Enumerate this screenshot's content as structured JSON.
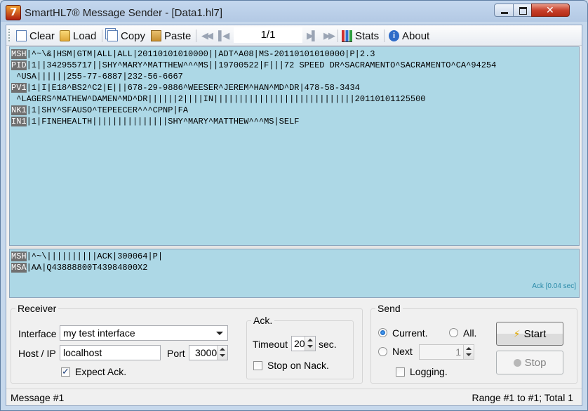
{
  "window": {
    "title": "SmartHL7® Message Sender -  [Data1.hl7]"
  },
  "toolbar": {
    "clear": "Clear",
    "load": "Load",
    "copy": "Copy",
    "paste": "Paste",
    "pager": "1/1",
    "stats": "Stats",
    "about": "About"
  },
  "message": {
    "lines": [
      {
        "seg": "MSH",
        "text": "|^~\\&|HSM|GTM|ALL|ALL|20110101010000||ADT^A08|MS-20110101010000|P|2.3"
      },
      {
        "seg": "PID",
        "text": "|1||342955717||SHY^MARY^MATTHEW^^^MS||19700522|F|||72 SPEED DR^SACRAMENTO^SACRAMENTO^CA^94254"
      },
      {
        "seg": "",
        "text": " ^USA||||||255-77-6887|232-56-6667"
      },
      {
        "seg": "PV1",
        "text": "|1|I|E18^BS2^C2|E|||678-29-9886^WEESER^JEREM^HAN^MD^DR|478-58-3434"
      },
      {
        "seg": "",
        "text": " ^LAGERS^MATHEW^DAMEN^MD^DR||||||2||||IN||||||||||||||||||||||||||||20110101125500"
      },
      {
        "seg": "NK1",
        "text": "|1|SHY^SFAUSO^TEPEECER^^^CPNP|FA"
      },
      {
        "seg": "IN1",
        "text": "|1|FINEHEALTH|||||||||||||||SHY^MARY^MATTHEW^^^MS|SELF"
      }
    ]
  },
  "ack": {
    "lines": [
      {
        "seg": "MSH",
        "text": "|^~\\||||||||||ACK|300064|P|"
      },
      {
        "seg": "MSA",
        "text": "|AA|Q43888800T43984800X2"
      }
    ],
    "time": "Ack [0.04 sec]"
  },
  "receiver": {
    "title": "Receiver",
    "interface_label": "Interface",
    "interface_value": "my test interface",
    "host_label": "Host / IP",
    "host_value": "localhost",
    "port_label": "Port",
    "port_value": "3000",
    "expect_ack_label": "Expect Ack.",
    "expect_ack_checked": true
  },
  "ack_options": {
    "title": "Ack.",
    "timeout_label": "Timeout",
    "timeout_value": "20",
    "timeout_unit": "sec.",
    "stop_on_nack_label": "Stop on Nack.",
    "stop_on_nack_checked": false
  },
  "send": {
    "title": "Send",
    "current_label": "Current.",
    "all_label": "All.",
    "next_label": "Next",
    "next_value": "1",
    "logging_label": "Logging.",
    "selected": "current",
    "start_label": "Start",
    "stop_label": "Stop"
  },
  "status": {
    "left": "Message #1",
    "right": "Range #1 to #1; Total 1"
  }
}
